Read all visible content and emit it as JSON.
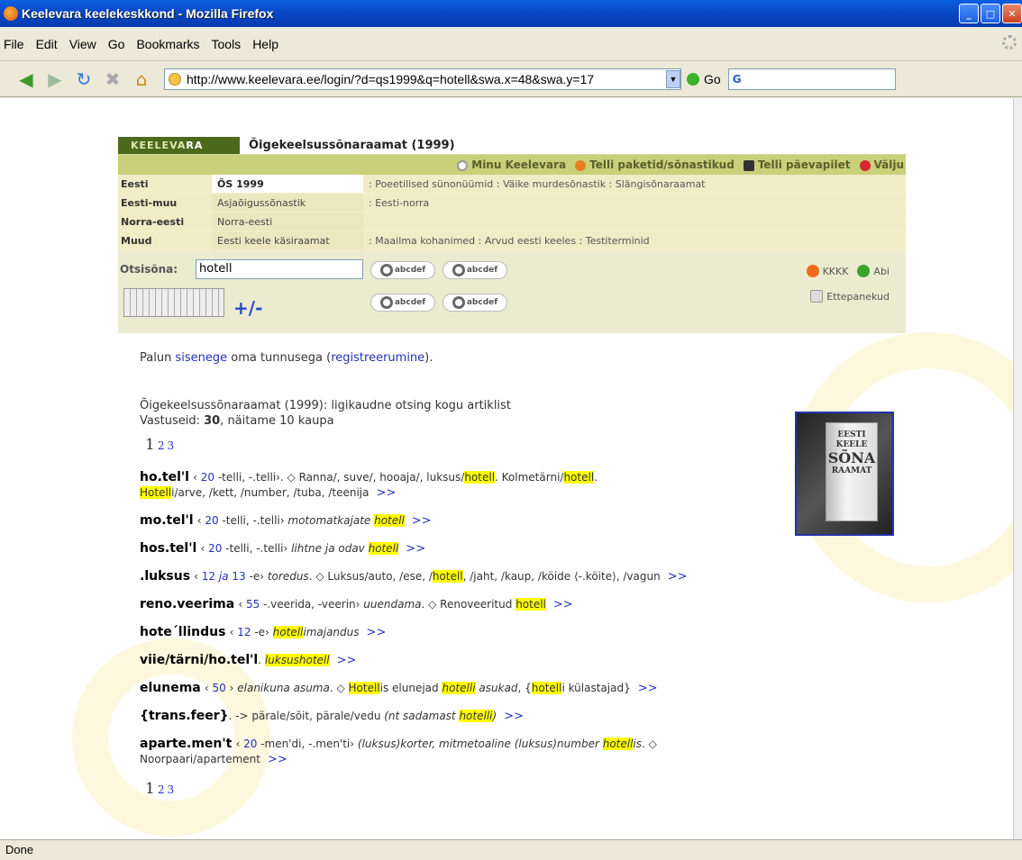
{
  "window": {
    "title": "Keelevara keelekeskkond - Mozilla Firefox"
  },
  "menu": [
    "File",
    "Edit",
    "View",
    "Go",
    "Bookmarks",
    "Tools",
    "Help"
  ],
  "toolbar": {
    "url": "http://www.keelevara.ee/login/?d=qs1999&q=hotell&swa.x=48&swa.y=17",
    "go_label": "Go",
    "search_logo": "G"
  },
  "status": "Done",
  "panel": {
    "logo_a": "KEELEVA",
    "logo_b": "RA",
    "dict_title": "Õigekeelsussõnaraamat (1999)",
    "topnav": [
      "Minu Keelevara",
      "Telli paketid/sõnastikud",
      "Telli päevapilet",
      "Välju"
    ],
    "categories": [
      {
        "head": "Eesti",
        "sel": "ÕS 1999",
        "rest": ":  Poeetilised sünonüümid   :  Väike murdesõnastik   :  Slängisõnaraamat"
      },
      {
        "head": "Eesti-muu",
        "sel": "Asjaõigussõnastik",
        "rest": ":  Eesti-norra"
      },
      {
        "head": "Norra-eesti",
        "sel": "Norra-eesti",
        "rest": ""
      },
      {
        "head": "Muud",
        "sel": "Eesti keele käsiraamat",
        "rest": ":  Maailma kohanimed        :  Arvud eesti keeles        :  Testiterminid"
      }
    ],
    "search_label": "Otsisõna:",
    "search_value": "hotell",
    "lens_a": "abcdef",
    "lens_b": "abcdef",
    "plusminus": "+/-",
    "kkkk": "KKKK",
    "abi": "Abi",
    "ettepanekud": "Ettepanekud"
  },
  "content": {
    "login_pre": "Palun ",
    "login_link": "sisenege",
    "login_mid": " oma tunnusega (",
    "login_link2": "registreerumine",
    "login_post": ").",
    "summary1": "Õigekeelsussõnaraamat (1999): ligikaudne otsing kogu artiklist",
    "summary2_pre": "Vastuseid: ",
    "summary2_num": "30",
    "summary2_post": ", näitame 10 kaupa",
    "pages": [
      "1",
      "2",
      "3"
    ],
    "more": ">>",
    "book_top": "EESTI KEELE",
    "book_mid": "SÕNA",
    "book_bot": "RAAMAT"
  }
}
